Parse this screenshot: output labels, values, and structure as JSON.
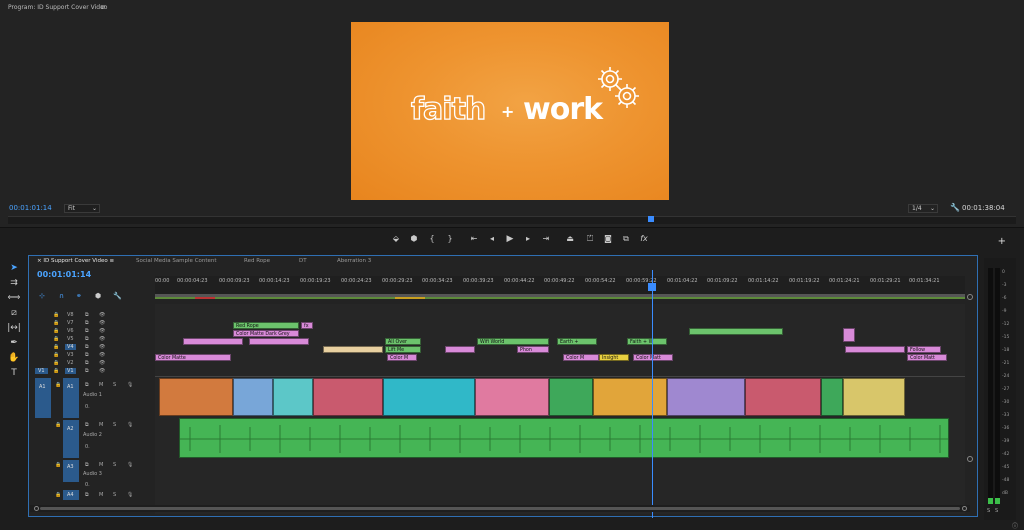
{
  "program_monitor": {
    "title": "Program: ID Support Cover Video",
    "menu_icon": "hamburger-icon",
    "timecode_left": "00:01:01:14",
    "fit": "Fit",
    "scale": "1/4",
    "timecode_right": "00:01:38:04",
    "frame_text": {
      "left": "faith",
      "plus": "+",
      "right": "work"
    },
    "frame_colors": {
      "bg": "#ec8f2b",
      "text": "#ffffff"
    }
  },
  "transport": {
    "buttons": [
      "add-marker-icon",
      "marker-icon",
      "mark-in-icon",
      "mark-out-icon",
      "go-to-in-icon",
      "step-back-icon",
      "play-icon",
      "step-forward-icon",
      "go-to-out-icon",
      "lift-icon",
      "extract-icon",
      "export-frame-icon",
      "compare-icon",
      "fx-icon"
    ],
    "add_button": "+"
  },
  "timeline": {
    "tabs": [
      "ID Support Cover Video",
      "Social Media Sample Content",
      "Red Rope",
      "DT",
      "Aberration 3"
    ],
    "timecode": "00:01:01:14",
    "ruler_labels": [
      "00:00",
      "00:00:04:23",
      "00:00:09:23",
      "00:00:14:23",
      "00:00:19:23",
      "00:00:24:23",
      "00:00:29:23",
      "00:00:34:23",
      "00:00:39:23",
      "00:00:44:22",
      "00:00:49:22",
      "00:00:54:22",
      "00:00:59:22",
      "00:01:04:22",
      "00:01:09:22",
      "00:01:14:22",
      "00:01:19:22",
      "00:01:24:21",
      "00:01:29:21",
      "00:01:34:21"
    ],
    "video_tracks": [
      "V8",
      "V7",
      "V6",
      "V5",
      "V4",
      "V3",
      "V2",
      "V1"
    ],
    "video_source": "V1",
    "audio_tracks": [
      {
        "id": "A1",
        "name": "Audio 1",
        "vol": "0."
      },
      {
        "id": "A2",
        "name": "Audio 2",
        "vol": "0."
      },
      {
        "id": "A3",
        "name": "Audio 3",
        "vol": "0."
      },
      {
        "id": "A4",
        "name": "",
        "vol": ""
      }
    ],
    "track_btns": {
      "mute": "M",
      "solo": "S"
    },
    "clip_labels": {
      "red_rope": "Red Rope",
      "color_matte_dark": "Color Matte Dark Grey",
      "all_over": "All Over",
      "lift_me": "Lift Me",
      "wifi_world": "Wifi World",
      "phon": "Phon",
      "color_m": "Color M",
      "color_matte": "Color Matte",
      "earth": "Earth +",
      "faith_w": "Faith + W",
      "insight": "Insight",
      "color_matt": "Color Matt",
      "follow": "Follow",
      "color_matte2": "Color Matt",
      "fx": "fx"
    }
  },
  "meter": {
    "labels": [
      "0",
      "-3",
      "-6",
      "-9",
      "-12",
      "-15",
      "-18",
      "-21",
      "-24",
      "-27",
      "-30",
      "-33",
      "-36",
      "-39",
      "-42",
      "-45",
      "-48",
      "dB"
    ],
    "solo_buttons": [
      "S",
      "S"
    ]
  },
  "tools": [
    "selection-tool-icon",
    "track-select-icon",
    "ripple-edit-icon",
    "razor-icon",
    "slip-icon",
    "pen-icon",
    "hand-icon",
    "type-icon"
  ]
}
